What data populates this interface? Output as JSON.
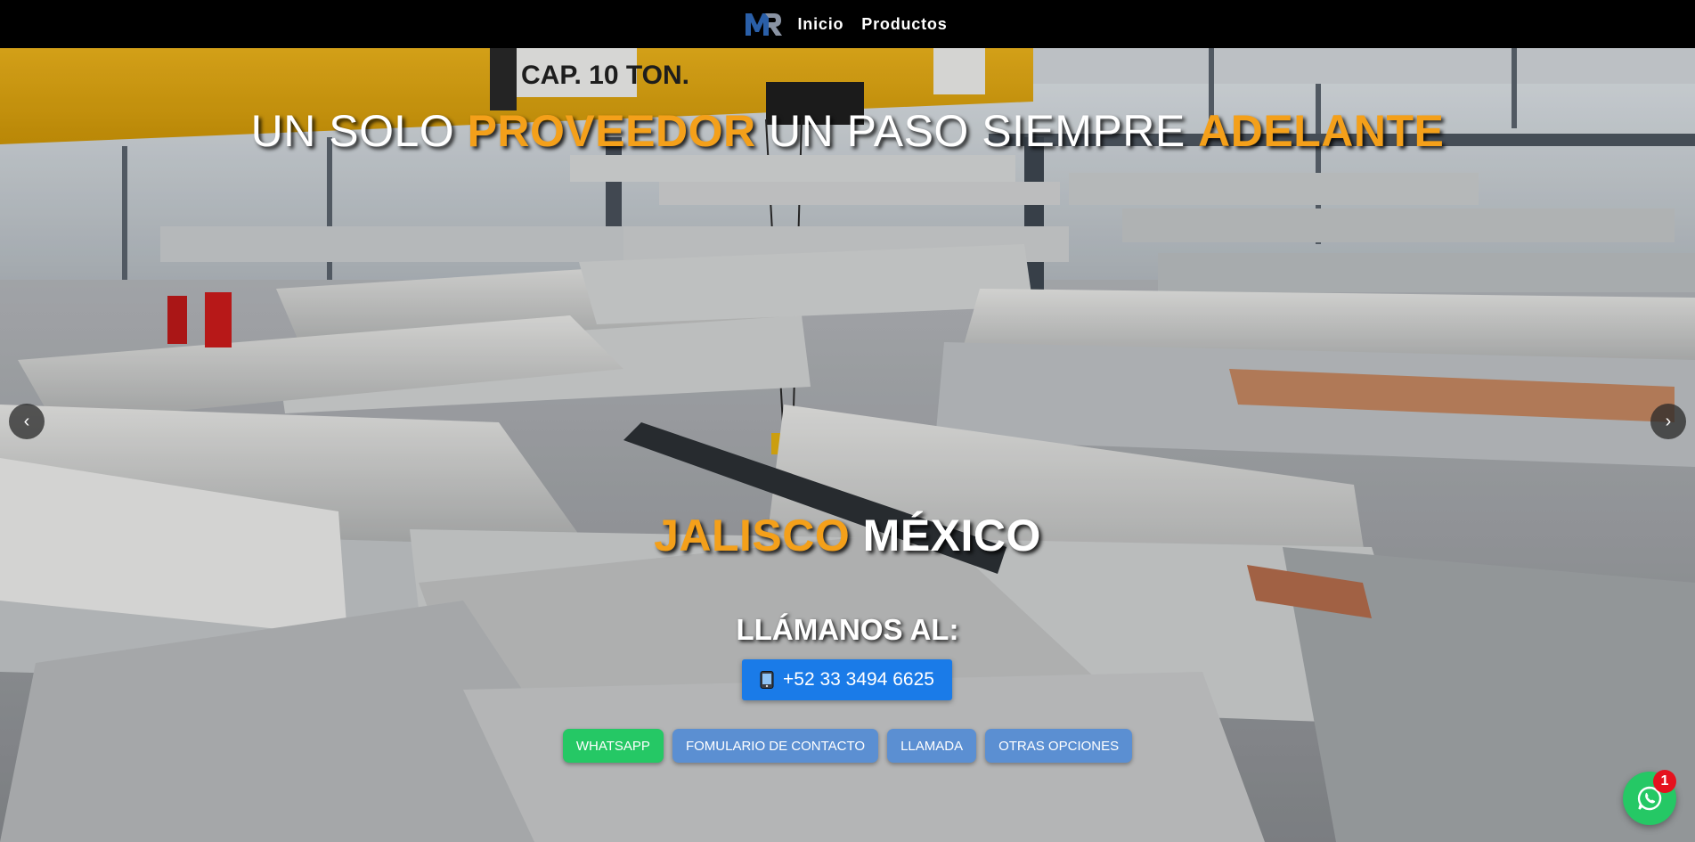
{
  "nav": {
    "logo_text": "MR",
    "links": [
      {
        "label": "Inicio"
      },
      {
        "label": "Productos"
      }
    ]
  },
  "hero": {
    "headline": {
      "part1": "UN SOLO ",
      "highlight1": "PROVEEDOR",
      "part2": " UN PASO SIEMPRE ",
      "highlight2": "ADELANTE"
    },
    "location": {
      "highlight": "JALISCO",
      "rest": " MÉXICO"
    },
    "background_sign": "CAP. 10 TON.",
    "call_label": "LLÁMANOS AL:",
    "phone": "+52 33 3494 6625",
    "options": [
      {
        "label": "WHATSAPP",
        "color": "#25c865"
      },
      {
        "label": "FOMULARIO DE CONTACTO",
        "color": "#5b8fd2"
      },
      {
        "label": "LLAMADA",
        "color": "#5b8fd2"
      },
      {
        "label": "OTRAS OPCIONES",
        "color": "#5b8fd2"
      }
    ],
    "carousel": {
      "prev": "‹",
      "next": "›"
    }
  },
  "whatsapp_widget": {
    "badge_count": "1"
  },
  "colors": {
    "accent": "#f4a01a",
    "phone_button": "#1a7be8",
    "whatsapp": "#25c865"
  }
}
